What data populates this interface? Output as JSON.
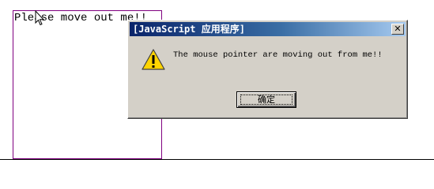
{
  "page": {
    "target_text": "Please move out me!!"
  },
  "dialog": {
    "title": "[JavaScript 应用程序]",
    "close_glyph": "✕",
    "icon": "warning-icon",
    "message": "The mouse pointer are moving out from me!!",
    "ok_label": "确定"
  },
  "colors": {
    "target_border": "#800080",
    "dialog_bg": "#d4d0c8",
    "titlebar_start": "#0a246a",
    "titlebar_end": "#a6caf0",
    "warning_yellow": "#ffd400"
  }
}
